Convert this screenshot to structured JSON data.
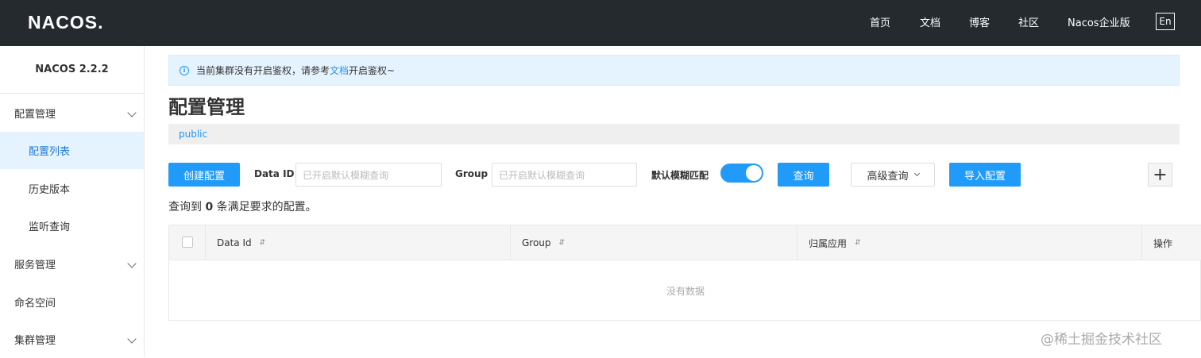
{
  "header": {
    "logo": "NACOS",
    "logo_dot": ".",
    "nav": [
      "首页",
      "文档",
      "博客",
      "社区",
      "Nacos企业版"
    ],
    "lang": "En"
  },
  "sidebar": {
    "version": "NACOS 2.2.2",
    "items": [
      {
        "label": "配置管理"
      },
      {
        "label": "配置列表"
      },
      {
        "label": "历史版本"
      },
      {
        "label": "监听查询"
      },
      {
        "label": "服务管理"
      },
      {
        "label": "命名空间"
      },
      {
        "label": "集群管理"
      }
    ]
  },
  "notice": {
    "prefix": "当前集群没有开启鉴权，请参考",
    "link": "文档",
    "suffix": "开启鉴权~"
  },
  "page": {
    "title": "配置管理",
    "namespace": "public"
  },
  "toolbar": {
    "create": "创建配置",
    "dataid_label": "Data ID",
    "dataid_placeholder": "已开启默认模糊查询",
    "group_label": "Group",
    "group_placeholder": "已开启默认模糊查询",
    "fuzzy_label": "默认模糊匹配",
    "query": "查询",
    "advanced": "高级查询",
    "import": "导入配置",
    "plus": "+"
  },
  "result": {
    "prefix": "查询到 ",
    "count": "0",
    "suffix": " 条满足要求的配置。"
  },
  "table": {
    "columns": [
      "Data Id",
      "Group",
      "归属应用",
      "操作"
    ],
    "sort_icon": "⇵",
    "empty": "没有数据"
  },
  "watermark": "@稀土掘金技术社区"
}
